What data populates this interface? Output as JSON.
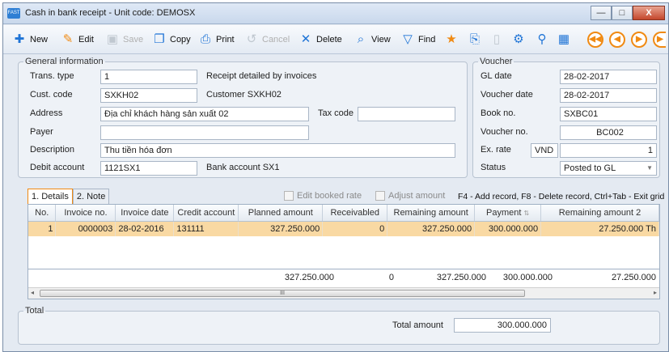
{
  "window": {
    "title": "Cash in bank receipt - Unit code: DEMOSX",
    "icon": "app-icon",
    "btn_min": "—",
    "btn_max": "□",
    "btn_close": "X"
  },
  "toolbar": {
    "new": "New",
    "edit": "Edit",
    "save": "Save",
    "copy": "Copy",
    "print": "Print",
    "cancel": "Cancel",
    "delete": "Delete",
    "view": "View",
    "find": "Find"
  },
  "general": {
    "legend": "General information",
    "trans_type_label": "Trans. type",
    "trans_type_value": "1",
    "trans_type_desc": "Receipt detailed by invoices",
    "cust_code_label": "Cust. code",
    "cust_code_value": "SXKH02",
    "cust_code_desc": "Customer SXKH02",
    "address_label": "Address",
    "address_value": "Địa chỉ khách hàng sản xuất 02",
    "tax_code_label": "Tax code",
    "tax_code_value": "",
    "payer_label": "Payer",
    "payer_value": "",
    "description_label": "Description",
    "description_value": "Thu tiền hóa đơn",
    "debit_account_label": "Debit account",
    "debit_account_value": "1121SX1",
    "debit_account_desc": "Bank account SX1"
  },
  "voucher": {
    "legend": "Voucher",
    "gl_date_label": "GL date",
    "gl_date_value": "28-02-2017",
    "voucher_date_label": "Voucher date",
    "voucher_date_value": "28-02-2017",
    "book_no_label": "Book no.",
    "book_no_value": "SXBC01",
    "voucher_no_label": "Voucher no.",
    "voucher_no_value": "BC002",
    "ex_rate_label": "Ex. rate",
    "currency": "VND",
    "ex_rate_value": "1",
    "status_label": "Status",
    "status_value": "Posted to GL"
  },
  "tabs": [
    "1. Details",
    "2. Note"
  ],
  "options": {
    "edit_booked_rate": "Edit booked rate",
    "adjust_amount": "Adjust amount"
  },
  "hint": "F4 - Add record, F8 - Delete record, Ctrl+Tab - Exit grid",
  "grid": {
    "columns": [
      "No.",
      "Invoice no.",
      "Invoice date",
      "Credit account",
      "Planned amount",
      "Receivabled",
      "Remaining amount",
      "Payment",
      "Remaining amount 2"
    ],
    "rows": [
      {
        "no": "1",
        "invoice_no": "0000003",
        "invoice_date": "28-02-2016",
        "credit_account": "131111",
        "planned": "327.250.000",
        "receivabled": "0",
        "remaining": "327.250.000",
        "payment": "300.000.000",
        "remaining2": "27.250.000",
        "extra": "Th"
      }
    ],
    "totals": {
      "planned": "327.250.000",
      "receivabled": "0",
      "remaining": "327.250.000",
      "payment": "300.000.000",
      "remaining2": "27.250.000"
    },
    "scroll_thumb": "III"
  },
  "total": {
    "legend": "Total",
    "amount_label": "Total amount",
    "amount_value": "300.000.000"
  }
}
